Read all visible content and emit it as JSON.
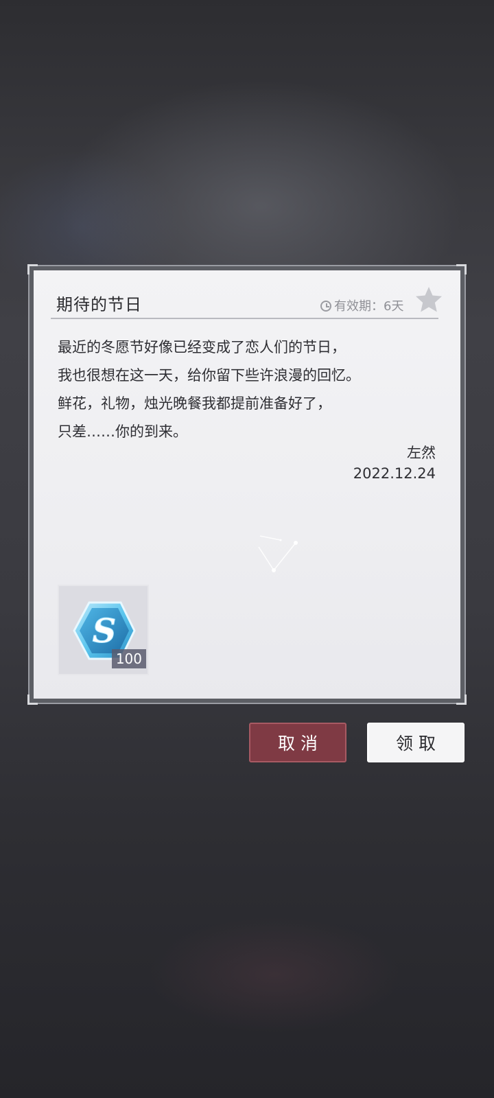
{
  "letter": {
    "title": "期待的节日",
    "validity_label": "有效期：6天",
    "body_lines": [
      "最近的冬愿节好像已经变成了恋人们的节日，",
      "我也很想在这一天，给你留下些许浪漫的回忆。",
      "鲜花，礼物，烛光晚餐我都提前准备好了，",
      "只差……你的到来。"
    ],
    "signature": "左然",
    "date": "2022.12.24"
  },
  "reward": {
    "icon": "s-hexagon-currency-icon",
    "count": "100"
  },
  "buttons": {
    "cancel_label": "取消",
    "claim_label": "领取"
  },
  "colors": {
    "cancel_button": "#7f3a44",
    "claim_button": "#f5f5f6",
    "card_background": "#f0f0f3"
  }
}
